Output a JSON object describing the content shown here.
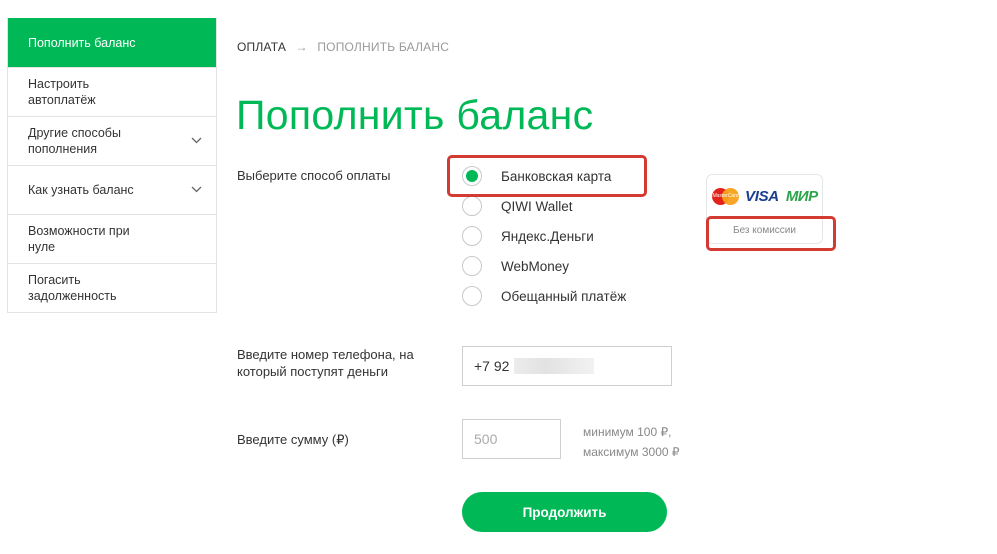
{
  "sidebar": {
    "items": [
      {
        "label": "Пополнить баланс",
        "active": true
      },
      {
        "label": "Настроить автоплатёж"
      },
      {
        "label": "Другие способы пополнения",
        "expandable": true
      },
      {
        "label": "Как узнать баланс",
        "expandable": true
      },
      {
        "label": "Возможности при нуле"
      },
      {
        "label": "Погасить задолженность"
      }
    ]
  },
  "breadcrumb": {
    "items": [
      "ОПЛАТА",
      "ПОПОЛНИТЬ БАЛАНС"
    ],
    "separator": "→"
  },
  "page_title": "Пополнить баланс",
  "payment": {
    "label": "Выберите способ оплаты",
    "options": [
      {
        "label": "Банковская карта",
        "selected": true
      },
      {
        "label": "QIWI Wallet",
        "selected": false
      },
      {
        "label": "Яндекс.Деньги",
        "selected": false
      },
      {
        "label": "WebMoney",
        "selected": false
      },
      {
        "label": "Обещанный платёж",
        "selected": false
      }
    ],
    "card_badge": {
      "logos": [
        "MasterCard",
        "VISA",
        "МИР"
      ],
      "note": "Без комиссии"
    }
  },
  "phone": {
    "label": "Введите номер телефона, на который поступят деньги",
    "value": "+7 92"
  },
  "sum": {
    "label": "Введите сумму (₽)",
    "placeholder": "500",
    "min_hint": "минимум 100 ₽,",
    "max_hint": "максимум 3000 ₽"
  },
  "submit_label": "Продолжить",
  "colors": {
    "accent": "#00b956",
    "highlight": "#d23a32"
  }
}
